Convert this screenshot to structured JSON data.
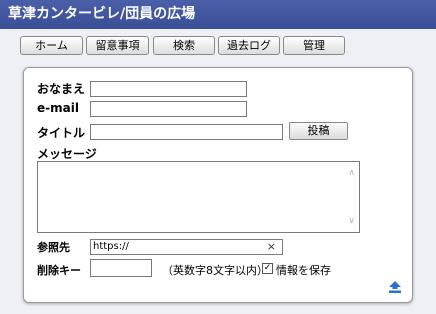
{
  "header": {
    "title": "草津カンタービレ/団員の広場"
  },
  "nav": {
    "items": [
      "ホーム",
      "留意事項",
      "検索",
      "過去ログ",
      "管理"
    ]
  },
  "form": {
    "name_label": "おなまえ",
    "name_value": "",
    "email_label": "e-mail",
    "email_value": "",
    "title_label": "タイトル",
    "title_value": "",
    "post_button": "投稿",
    "message_label": "メッセージ",
    "message_value": "",
    "url_label": "参照先",
    "url_value": "https://",
    "clear_symbol": "×",
    "delkey_label": "削除キー",
    "delkey_value": "",
    "delkey_note": "（英数字8文字以内）",
    "save_label": "情報を保存",
    "save_checked": true
  },
  "icons": {
    "page_top": "arrow-up-icon",
    "accent": "#2a6fd6"
  }
}
